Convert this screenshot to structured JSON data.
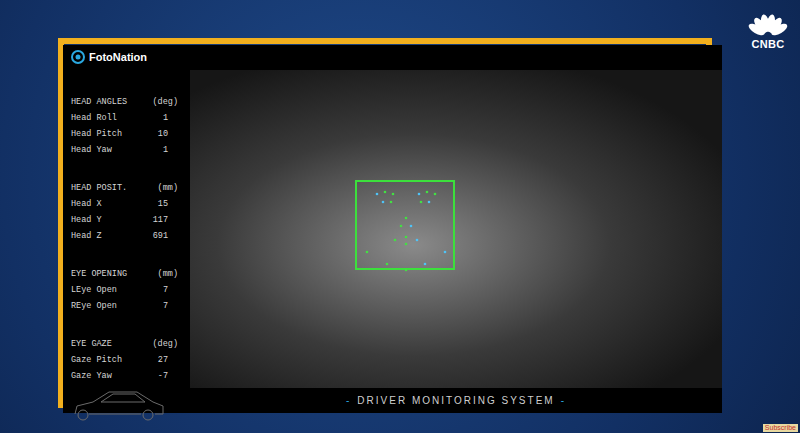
{
  "brand": {
    "logo": "FotoNation",
    "channel": "CNBC"
  },
  "metrics": [
    {
      "title": "HEAD ANGLES",
      "unit": "(deg)",
      "rows": [
        {
          "label": "Head Roll",
          "value": "1"
        },
        {
          "label": "Head Pitch",
          "value": "10"
        },
        {
          "label": "Head Yaw",
          "value": "1"
        }
      ]
    },
    {
      "title": "HEAD POSIT.",
      "unit": "(mm)",
      "rows": [
        {
          "label": "Head X",
          "value": "15"
        },
        {
          "label": "Head Y",
          "value": "117"
        },
        {
          "label": "Head Z",
          "value": "691"
        }
      ]
    },
    {
      "title": "EYE OPENING",
      "unit": "(mm)",
      "rows": [
        {
          "label": "LEye Open",
          "value": "7"
        },
        {
          "label": "REye Open",
          "value": "7"
        }
      ]
    },
    {
      "title": "EYE GAZE",
      "unit": "(deg)",
      "rows": [
        {
          "label": "Gaze Pitch",
          "value": "27"
        },
        {
          "label": "Gaze Yaw",
          "value": "-7"
        }
      ]
    }
  ],
  "face_detected": true,
  "footer": {
    "text": "DRIVER MONITORING SYSTEM",
    "mark": "-"
  },
  "subscribe": "Subscribe"
}
